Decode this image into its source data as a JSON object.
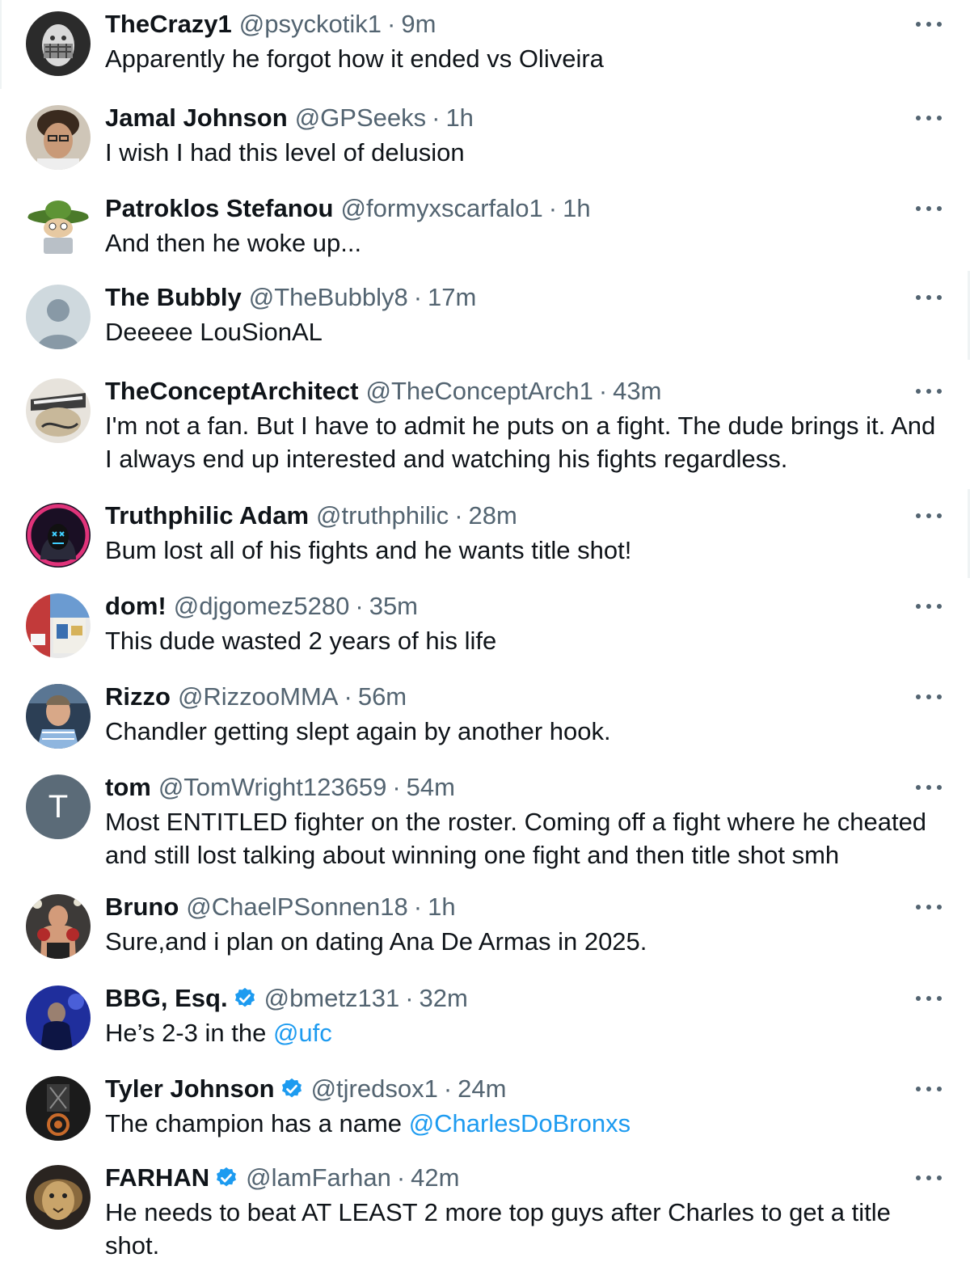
{
  "replies": [
    {
      "name": "TheCrazy1",
      "handle": "@psyckotik1",
      "time": "9m",
      "text": "Apparently he forgot how it ended vs Oliveira"
    },
    {
      "name": "Jamal Johnson",
      "handle": "@GPSeeks",
      "time": "1h",
      "text": "I wish I had this level of delusion"
    },
    {
      "name": "Patroklos Stefanou",
      "handle": "@formyxscarfalo1",
      "time": "1h",
      "text": "And then he woke up..."
    },
    {
      "name": "The Bubbly",
      "handle": "@TheBubbly8",
      "time": "17m",
      "text": "Deeeee LouSionAL"
    },
    {
      "name": "TheConceptArchitect",
      "handle": "@TheConceptArch1",
      "time": "43m",
      "text": "I'm not a fan. But I have to admit he puts on a fight. The dude brings it. And I always end up interested and watching his fights regardless."
    },
    {
      "name": "Truthphilic Adam",
      "handle": "@truthphilic",
      "time": "28m",
      "text": "Bum lost all of his fights and he wants title shot!"
    },
    {
      "name": "dom!",
      "handle": "@djgomez5280",
      "time": "35m",
      "text": "This dude wasted 2 years of his life"
    },
    {
      "name": "Rizzo",
      "handle": "@RizzooMMA",
      "time": "56m",
      "text": "Chandler getting slept again by another hook."
    },
    {
      "name": "tom",
      "handle": "@TomWright123659",
      "time": "54m",
      "text": "Most ENTITLED fighter on the roster. Coming off a fight where he cheated and still lost talking about winning one fight and then title shot smh",
      "avatar_letter": "T"
    },
    {
      "name": "Bruno",
      "handle": "@ChaelPSonnen18",
      "time": "1h",
      "text": "Sure,and i plan on dating Ana De Armas in 2025."
    },
    {
      "name": "BBG, Esq.",
      "handle": "@bmetz131",
      "time": "32m",
      "text": "He’s 2-3 in the",
      "mention": "@ufc",
      "verified": true
    },
    {
      "name": "Tyler Johnson",
      "handle": "@tjredsox1",
      "time": "24m",
      "text": "The champion has a name",
      "mention": "@CharlesDoBronxs",
      "verified": true
    },
    {
      "name": "FARHAN",
      "handle": "@lamFarhan",
      "time": "42m",
      "text": "He needs to beat AT LEAST 2 more top guys after Charles to get a title shot.",
      "verified": true
    }
  ],
  "separator": "·",
  "colors": {
    "text": "#0f1419",
    "secondary": "#536471",
    "link": "#1d9bf0",
    "verified": "#1d9bf0"
  }
}
